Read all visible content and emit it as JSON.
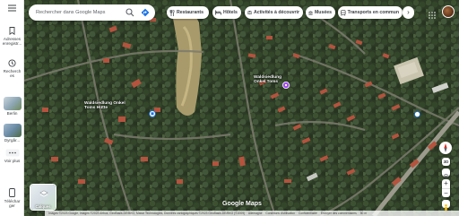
{
  "rail": {
    "items": [
      {
        "label_line1": "Adresses",
        "label_line2": "enregistr..."
      },
      {
        "label_line1": "Recherch",
        "label_line2": "es"
      },
      {
        "label_line1": "Berlin",
        "label_line2": ""
      },
      {
        "label_line1": "Dyrgår...",
        "label_line2": ""
      },
      {
        "label_line1": "Voir plus",
        "label_line2": ""
      },
      {
        "label_line1": "Téléchar",
        "label_line2": "ger"
      }
    ]
  },
  "search": {
    "placeholder": "Rechercher dans Google Maps"
  },
  "chips": [
    {
      "label": "Restaurants",
      "icon": "restaurant-icon"
    },
    {
      "label": "Hôtels",
      "icon": "hotel-icon"
    },
    {
      "label": "Activités à découvrir",
      "icon": "camera-icon"
    },
    {
      "label": "Musées",
      "icon": "museum-icon"
    },
    {
      "label": "Transports en commun",
      "icon": "transit-icon"
    }
  ],
  "map": {
    "pin_label_line1": "Waldsiedlung",
    "pin_label_line2": "Zehlendorf",
    "area_label_line1": "Waldsiedlung Onkel",
    "area_label_line2": "Toms Hütte",
    "area_label_line3": "Waldsiedlung",
    "area_label_line4": "Onkel Toms",
    "layers_label": "Calques",
    "logo": "Google Maps"
  },
  "footer": {
    "items": [
      "Images ©2023 Google, Images ©2023 Airbus, GeoBasis-DE/BKG, Maxar Technologies, Données cartographiques ©2023 GeoBasis-DE/BKG (©2009)",
      "Allemagne",
      "Conditions d'utilisation",
      "Confidentialité",
      "Envoyer des commentaires",
      "50 m"
    ]
  },
  "colors": {
    "accent": "#1a73e8",
    "pin": "#a142f4"
  }
}
